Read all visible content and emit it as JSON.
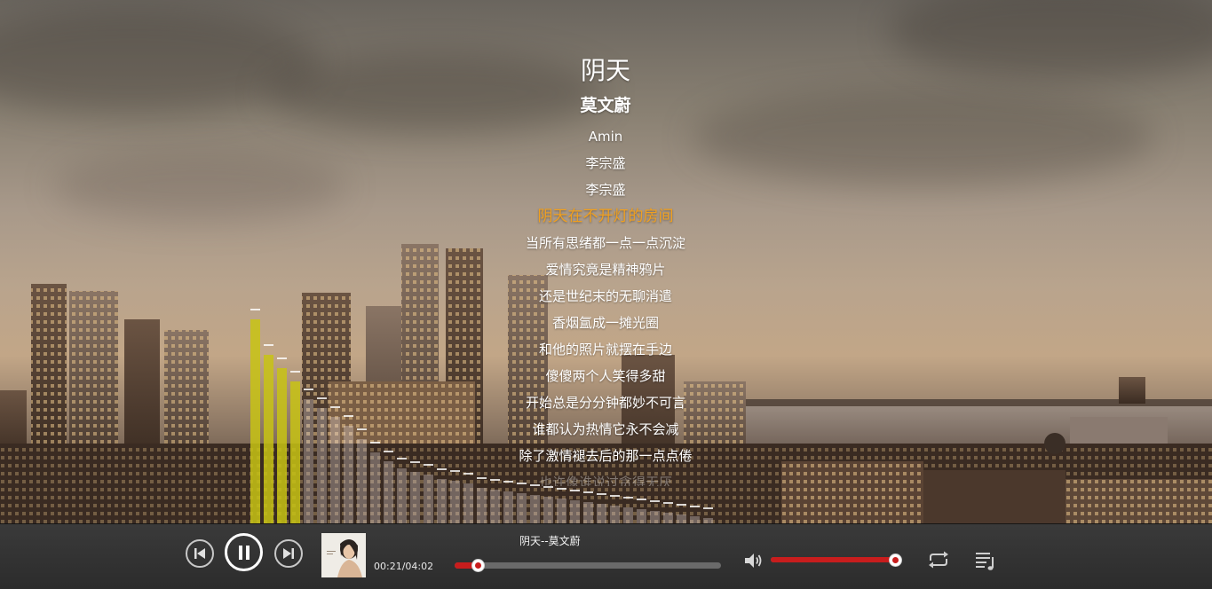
{
  "lyrics": {
    "title": "阴天",
    "artist": "莫文蔚",
    "lines": [
      {
        "text": "Amin",
        "state": "normal"
      },
      {
        "text": "李宗盛",
        "state": "normal"
      },
      {
        "text": "李宗盛",
        "state": "normal"
      },
      {
        "text": "阴天在不开灯的房间",
        "state": "active"
      },
      {
        "text": "当所有思绪都一点一点沉淀",
        "state": "normal"
      },
      {
        "text": "爱情究竟是精神鸦片",
        "state": "normal"
      },
      {
        "text": "还是世纪末的无聊消遣",
        "state": "normal"
      },
      {
        "text": "香烟氲成一摊光圈",
        "state": "normal"
      },
      {
        "text": "和他的照片就摆在手边",
        "state": "normal"
      },
      {
        "text": "傻傻两个人笑得多甜",
        "state": "normal"
      },
      {
        "text": "开始总是分分钟都妙不可言",
        "state": "normal"
      },
      {
        "text": "谁都认为热情它永不会减",
        "state": "normal"
      },
      {
        "text": "除了激情褪去后的那一点点倦",
        "state": "normal"
      },
      {
        "text": "也许像谁说过贪得无厌",
        "state": "fading"
      }
    ]
  },
  "player": {
    "track_label": "阴天--莫文蔚",
    "time_label": "00:21/04:02",
    "progress": 0.087,
    "volume": 1.0,
    "colors": {
      "accent": "#c81d1d",
      "lyric_active": "#f0a020",
      "bar_bg": "#2e2e2e"
    }
  },
  "icons": {
    "prev": "previous-track-icon",
    "play_pause": "pause-icon",
    "next": "next-track-icon",
    "volume": "speaker-icon",
    "loop": "loop-icon",
    "playlist": "playlist-icon"
  }
}
